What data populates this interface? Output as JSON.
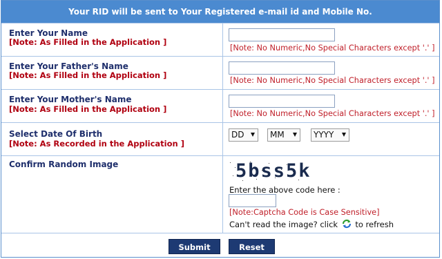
{
  "header": {
    "title": "Your RID will be sent to Your Registered e-mail id and Mobile No."
  },
  "fields": {
    "name": {
      "label": "Enter Your Name",
      "note": "[Note: As Filled in the Application ]",
      "value": "",
      "hint": "[Note: No Numeric,No Special Characters except '.' ]"
    },
    "father": {
      "label": "Enter Your Father's Name",
      "note": "[Note: As Filled in the Application ]",
      "value": "",
      "hint": "[Note: No Numeric,No Special Characters except '.' ]"
    },
    "mother": {
      "label": "Enter Your Mother's Name",
      "note": "[Note: As Filled in the Application ]",
      "value": "",
      "hint": "[Note: No Numeric,No Special Characters except '.' ]"
    }
  },
  "dob": {
    "label": "Select Date Of Birth",
    "note": "[Note: As Recorded in the Application ]",
    "day": "DD",
    "month": "MM",
    "year": "YYYY"
  },
  "captcha": {
    "label": "Confirm Random Image",
    "image_text": "5bss5k",
    "instruction": "Enter the above code here :",
    "value": "",
    "note": "[Note:Captcha Code is Case Sensitive]",
    "refresh_prefix": "Can't read the image? click",
    "refresh_suffix": "to refresh"
  },
  "buttons": {
    "submit": "Submit",
    "reset": "Reset"
  },
  "colors": {
    "header_bg": "#4b8ad0",
    "label": "#1f2f6c",
    "note": "#b00010",
    "button_bg": "#1d3a73"
  }
}
